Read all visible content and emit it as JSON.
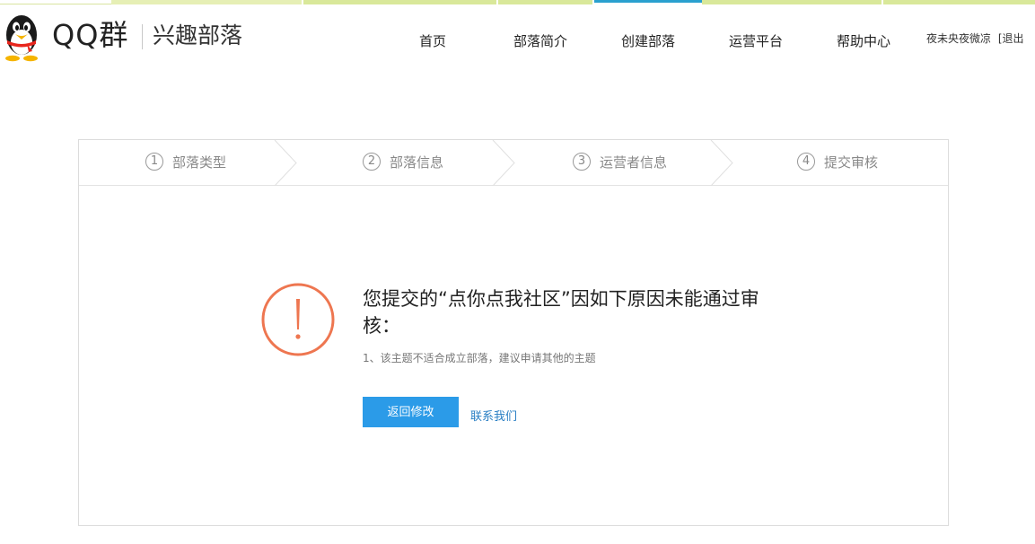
{
  "colors": {
    "accent": "#2aa0cf",
    "primary_button": "#2b9be8",
    "warning": "#ee7650",
    "link": "#2a7fc4",
    "top_strip": "#d9e89a"
  },
  "header": {
    "brand": "QQ群",
    "subtitle": "兴趣部落",
    "nav": [
      {
        "label": "首页"
      },
      {
        "label": "部落简介"
      },
      {
        "label": "创建部落"
      },
      {
        "label": "运营平台"
      },
      {
        "label": "帮助中心"
      }
    ],
    "active_nav_index": 2,
    "user": {
      "name": "夜未央夜微凉",
      "logout": "[退出"
    }
  },
  "steps": [
    {
      "number": "1",
      "label": "部落类型"
    },
    {
      "number": "2",
      "label": "部落信息"
    },
    {
      "number": "3",
      "label": "运营者信息"
    },
    {
      "number": "4",
      "label": "提交审核"
    }
  ],
  "result": {
    "icon": "warning-icon",
    "title": "您提交的“点你点我社区”因如下原因未能通过审核：",
    "reason": "1、该主题不适合成立部落，建议申请其他的主题",
    "return_button": "返回修改",
    "contact_link": "联系我们"
  }
}
